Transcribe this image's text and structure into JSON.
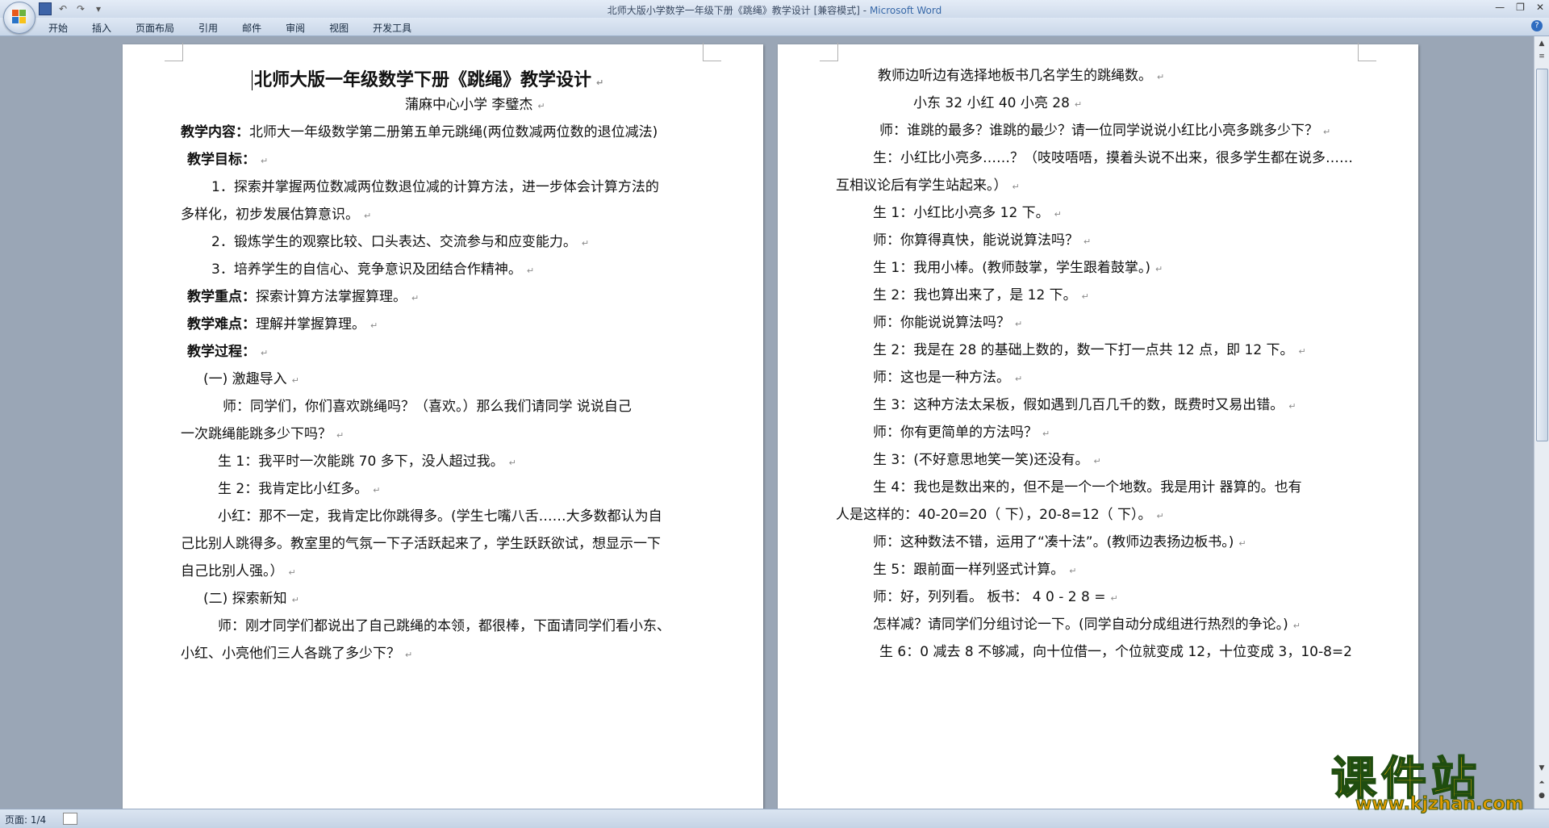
{
  "window": {
    "doc_name": "北师大版小学数学一年级下册《跳绳》教学设计 [兼容模式]",
    "separator": " - ",
    "app_name": "Microsoft Word"
  },
  "ribbon_tabs": [
    "开始",
    "插入",
    "页面布局",
    "引用",
    "邮件",
    "审阅",
    "视图",
    "开发工具"
  ],
  "status": {
    "page": "页面: 1/4"
  },
  "left_page": {
    "title": "北师大版一年级数学下册《跳绳》教学设计",
    "author_line": "蒲麻中心小学        李璧杰",
    "lines": [
      {
        "lbl": "教学内容：",
        "txt": "北师大一年级数学第二册第五单元跳绳(两位数减两位数的退位减法)"
      },
      {
        "lbl": "教学目标：",
        "txt": ""
      },
      {
        "lbl": "",
        "txt": "1．探索并掌握两位数减两位数退位减的计算方法，进一步体会计算方法的"
      },
      {
        "lbl": "",
        "txt": "多样化，初步发展估算意识。"
      },
      {
        "lbl": "",
        "txt": "2．锻炼学生的观察比较、口头表达、交流参与和应变能力。"
      },
      {
        "lbl": "",
        "txt": "3．培养学生的自信心、竞争意识及团结合作精神。"
      },
      {
        "lbl": "教学重点：",
        "txt": "探索计算方法掌握算理。"
      },
      {
        "lbl": "教学难点：",
        "txt": "理解并掌握算理。"
      },
      {
        "lbl": "教学过程：",
        "txt": ""
      },
      {
        "lbl": "",
        "txt": "(一)    激趣导入"
      },
      {
        "lbl": "",
        "txt": "师：同学们，你们喜欢跳绳吗？（喜欢。）那么我们请同学      说说自己"
      },
      {
        "lbl": "",
        "txt": "一次跳绳能跳多少下吗？"
      },
      {
        "lbl": "",
        "txt": "生 1：我平时一次能跳 70 多下，没人超过我。"
      },
      {
        "lbl": "",
        "txt": "生 2：我肯定比小红多。"
      },
      {
        "lbl": "",
        "txt": "小红：那不一定，我肯定比你跳得多。(学生七嘴八舌……大多数都认为自"
      },
      {
        "lbl": "",
        "txt": "己比别人跳得多。教室里的气氛一下子活跃起来了，学生跃跃欲试，想显示一下"
      },
      {
        "lbl": "",
        "txt": "自己比别人强。）"
      },
      {
        "lbl": "",
        "txt": "(二)    探索新知"
      },
      {
        "lbl": "",
        "txt": "师：刚才同学们都说出了自己跳绳的本领，都很棒，下面请同学们看小东、"
      },
      {
        "lbl": "",
        "txt": "小红、小亮他们三人各跳了多少下？"
      }
    ]
  },
  "right_page": {
    "lines": [
      "教师边听边有选择地板书几名学生的跳绳数。",
      "小东 32        小红 40      小亮 28",
      "师：谁跳的最多？谁跳的最少？请一位同学说说小红比小亮多跳多少下？",
      "生：小红比小亮多……？（吱吱唔唔，摸着头说不出来，很多学生都在说多……",
      "互相议论后有学生站起来。）",
      "生 1：小红比小亮多 12 下。",
      "师：你算得真快，能说说算法吗？",
      "生 1：我用小棒。(教师鼓掌，学生跟着鼓掌。)",
      "生 2：我也算出来了，是 12 下。",
      "师：你能说说算法吗？",
      "生 2：我是在 28 的基础上数的，数一下打一点共 12 点，即 12 下。",
      "师：这也是一种方法。",
      "生 3：这种方法太呆板，假如遇到几百几千的数，既费时又易出错。",
      "师：你有更简单的方法吗？",
      "生 3：(不好意思地笑一笑)还没有。",
      "生 4：我也是数出来的，但不是一个一个地数。我是用计      器算的。也有",
      "人是这样的：40-20=20（ 下），20-8=12（ 下）。",
      "师：这种数法不错，运用了“凑十法”。(教师边表扬边板书。)",
      "生 5：跟前面一样列竖式计算。",
      "师：好，列列看。      板书：          4 0 - 2 8 =",
      "怎样减？请同学们分组讨论一下。(同学自动分成组进行热烈的争论。)",
      "生 6：0 减去 8 不够减，向十位借一，个位就变成 12，十位变成 3，10-8=2"
    ]
  },
  "watermark": {
    "cn": "课件站",
    "url": "www.kjzhan.com"
  },
  "colors": {
    "accent": "#3768a8",
    "watermark_gold": "#f2b600"
  }
}
